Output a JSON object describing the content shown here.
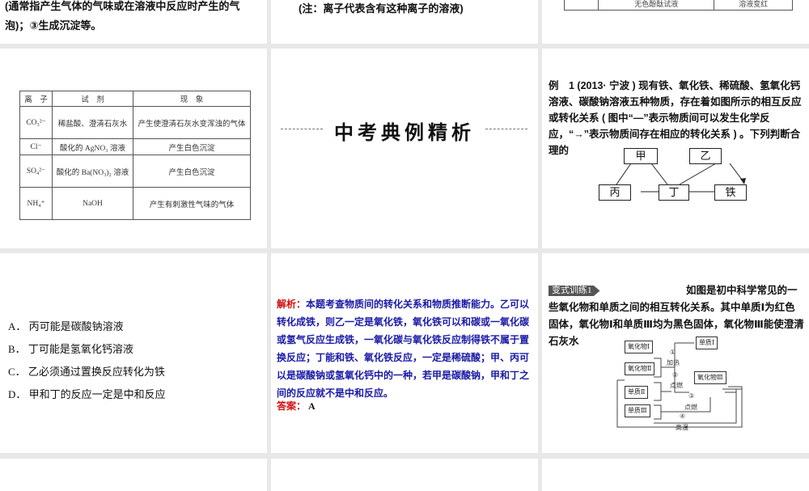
{
  "slide1": {
    "line1": "(通常指产生气体的气味或在溶液中反应时产生的气",
    "line2": "泡)；③生成沉淀等。"
  },
  "slide2": {
    "note": "(注：离子代表含有这种离子的溶液)"
  },
  "slide3": {
    "row": [
      "",
      "无色酚酞试液",
      "溶液变红"
    ]
  },
  "slide4": {
    "headers": [
      "离　子",
      "试　剂",
      "现　象"
    ],
    "rows": [
      [
        "CO₃²⁻",
        "稀盐酸、澄清石灰水",
        "产生使澄清石灰水变浑浊的气体"
      ],
      [
        "Cl⁻",
        "酸化的 AgNO₃ 溶液",
        "产生白色沉淀"
      ],
      [
        "SO₄²⁻",
        "酸化的 Ba(NO₃)₂ 溶液",
        "产生白色沉淀"
      ],
      [
        "NH₄⁺",
        "NaOH",
        "产生有刺激性气味的气体"
      ]
    ]
  },
  "slide5": {
    "title": "中考典例精析"
  },
  "slide6": {
    "text": "例　1 (2013· 宁波 ) 现有铁、氧化铁、稀硫酸、氢氧化钙溶液、碳酸钠溶液五种物质，存在着如图所示的相互反应或转化关系 ( 图中“—”表示物质间可以发生化学反应，“→”表示物质间存在相应的转化关系 ) 。下列判断合理的",
    "nodes": {
      "jia": "甲",
      "yi": "乙",
      "bing": "丙",
      "ding": "丁",
      "tie": "铁"
    }
  },
  "slide7": {
    "options": [
      "A． 丙可能是碳酸钠溶液",
      "B． 丁可能是氢氧化钙溶液",
      "C． 乙必须通过置换反应转化为铁",
      "D． 甲和丁的反应一定是中和反应"
    ]
  },
  "slide8": {
    "label": "解析：",
    "text": "本题考查物质间的转化关系和物质推断能力。乙可以转化成铁，则乙一定是氧化铁，氧化铁可以和碳或一氧化碳或氢气反应生成铁，一氧化碳与氧化铁反应制得铁不属于置换反应；丁能和铁、氧化铁反应，一定是稀硫酸；甲、丙可以是碳酸钠或氢氧化钙中的一种，若甲是碳酸钠，甲和丁之间的反应就不是中和反应。",
    "answer_label": "答案：",
    "answer": "A"
  },
  "slide9": {
    "badge": "变式训练1",
    "text": "如图是初中科学常见的一些氧化物和单质之间的相互转化关系。其中单质Ⅰ为红色固体，氧化物Ⅰ和单质Ⅲ均为黑色固体，氧化物Ⅲ能使澄清石灰水",
    "nodes": {
      "o1": "氧化物Ⅰ",
      "o2": "氧化物Ⅱ",
      "o3": "氧化物Ⅲ",
      "s1": "单质Ⅰ",
      "s2": "单质Ⅱ",
      "s3": "单质Ⅲ"
    },
    "labels": {
      "n1": "①",
      "c1": "加热",
      "n2": "②",
      "c2": "点燃",
      "n3": "③",
      "c3": "点燃",
      "n4": "④",
      "c4": "高温"
    }
  }
}
